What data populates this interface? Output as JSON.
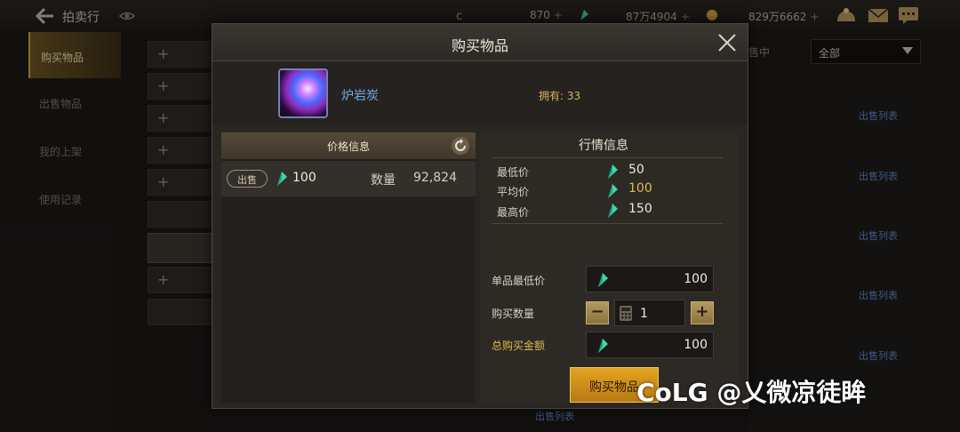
{
  "topbar": {
    "title": "拍卖行",
    "currencies": [
      {
        "icon": "coupon-icon",
        "value": "870"
      },
      {
        "icon": "gem-icon",
        "value": "87万4904"
      },
      {
        "icon": "gold-coin-icon",
        "value": "829万6662"
      }
    ],
    "plus": "+"
  },
  "sidebar": {
    "items": [
      {
        "label": "购买物品",
        "active": true
      },
      {
        "label": "出售物品",
        "active": false
      },
      {
        "label": "我的上架",
        "active": false
      },
      {
        "label": "使用记录",
        "active": false
      }
    ]
  },
  "right_panel": {
    "status": "售中",
    "filter": "全部",
    "sale_list_label": "出售列表"
  },
  "modal": {
    "title": "购买物品",
    "item": {
      "name": "炉岩炭",
      "owned": "拥有: 33"
    },
    "price_info": {
      "header": "价格信息",
      "rows": [
        {
          "tag": "出售",
          "price": "100",
          "qty_label": "数量",
          "qty": "92,824"
        }
      ]
    },
    "market": {
      "header": "行情信息",
      "min_label": "最低价",
      "min_value": "50",
      "avg_label": "平均价",
      "avg_value": "100",
      "max_label": "最高价",
      "max_value": "150"
    },
    "form": {
      "unit_min_label": "单品最低价",
      "unit_min_value": "100",
      "qty_label": "购买数量",
      "qty_value": "1",
      "minus": "−",
      "plus": "+",
      "total_label": "总购买金额",
      "total_value": "100"
    },
    "buy_button": "购买物品"
  },
  "watermark": "CoLG @乂微凉徒眸",
  "colors": {
    "accent_gold": "#e0b84f",
    "gem_teal": "#3fd6b0",
    "link_blue": "#5f86c9",
    "buy_orange": "#d8951c"
  }
}
